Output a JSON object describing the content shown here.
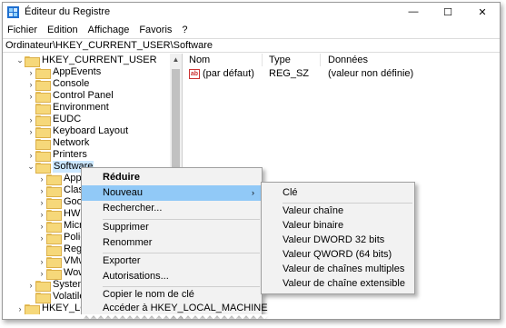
{
  "window": {
    "title": "Éditeur du Registre",
    "controls": {
      "minimize": "—",
      "maximize": "☐",
      "close": "✕"
    }
  },
  "menubar": [
    "Fichier",
    "Edition",
    "Affichage",
    "Favoris",
    "?"
  ],
  "address": "Ordinateur\\HKEY_CURRENT_USER\\Software",
  "tree": {
    "root": "HKEY_CURRENT_USER",
    "children": [
      "AppEvents",
      "Console",
      "Control Panel",
      "Environment",
      "EUDC",
      "Keyboard Layout",
      "Network",
      "Printers"
    ],
    "selected": "Software",
    "software_children": [
      "Appl",
      "Class",
      "Goog",
      "HWil",
      "Micr",
      "Polic",
      "Regis",
      "VMw",
      "Wow"
    ],
    "after": [
      "System",
      "Volatile"
    ],
    "next_root": "HKEY_LOC"
  },
  "list": {
    "headers": {
      "name": "Nom",
      "type": "Type",
      "data": "Données"
    },
    "rows": [
      {
        "name": "(par défaut)",
        "type": "REG_SZ",
        "data": "(valeur non définie)",
        "icon": "ab-string-icon"
      }
    ]
  },
  "context_menu": {
    "items": [
      "Réduire",
      "Nouveau",
      "Rechercher...",
      "Supprimer",
      "Renommer",
      "Exporter",
      "Autorisations...",
      "Copier le nom de clé",
      "Accéder à HKEY_LOCAL_MACHINE"
    ],
    "default_item": "Réduire",
    "highlighted": "Nouveau",
    "submenu_arrow": "›"
  },
  "submenu": {
    "items": [
      "Clé",
      "Valeur chaîne",
      "Valeur binaire",
      "Valeur DWORD 32 bits",
      "Valeur QWORD (64 bits)",
      "Valeur de chaînes multiples",
      "Valeur de chaîne extensible"
    ]
  },
  "colors": {
    "selection": "#cce8ff",
    "menu_highlight": "#91c9f7",
    "folder": "#f6d87a"
  }
}
